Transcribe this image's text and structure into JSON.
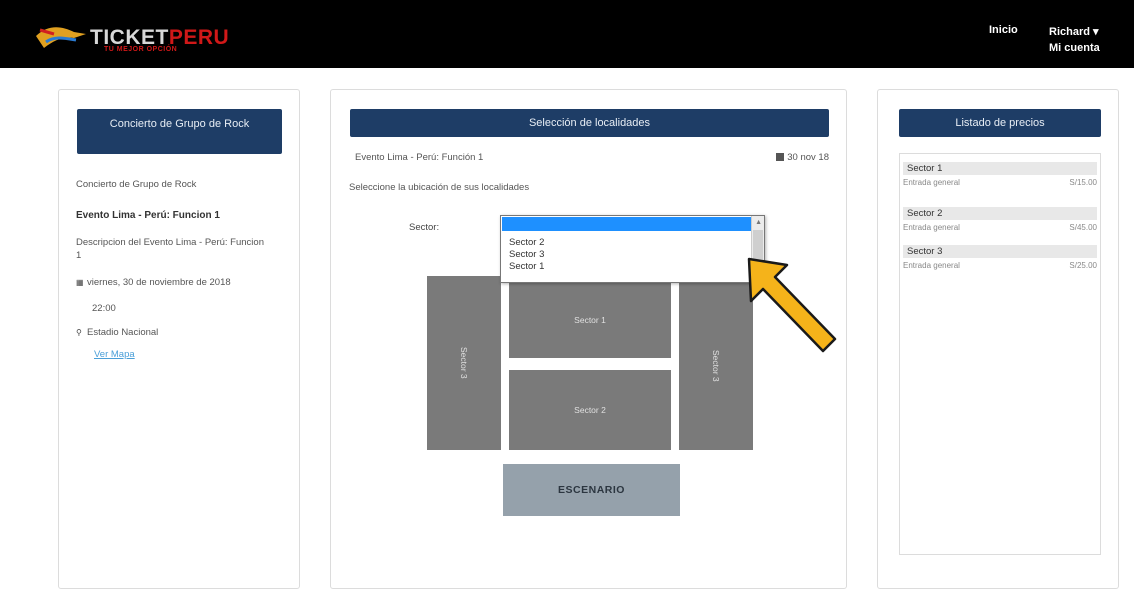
{
  "brand": {
    "name_part1": "TICKET",
    "name_part2": "PERU",
    "tagline": "TU MEJOR OPCIÓN"
  },
  "nav": {
    "inicio": "Inicio",
    "user": "Richard ▾",
    "account": "Mi cuenta"
  },
  "left": {
    "header": "Concierto de Grupo de Rock",
    "subtitle": "Concierto de Grupo de Rock",
    "event_title": "Evento Lima - Perú: Funcion 1",
    "description": "Descripcion del Evento Lima - Perú: Funcion 1",
    "date": "viernes, 30 de noviembre de 2018",
    "time": "22:00",
    "venue": "Estadio Nacional",
    "map_link": "Ver Mapa"
  },
  "mid": {
    "header": "Selección de localidades",
    "event": "Evento Lima - Perú: Función 1",
    "date": "30 nov 18",
    "instruction": "Seleccione la ubicación de sus localidades",
    "sector_label": "Sector:",
    "dropdown_options": [
      "Sector 2",
      "Sector 3",
      "Sector 1"
    ],
    "seat_map": {
      "left": "Sector 3",
      "top": "Sector 1",
      "right": "Sector 3",
      "bottom": "Sector 2",
      "stage": "ESCENARIO"
    }
  },
  "right": {
    "header": "Listado de precios",
    "sectors": [
      {
        "name": "Sector 1",
        "row": "Entrada general",
        "price": "S/15.00"
      },
      {
        "name": "Sector 2",
        "row": "Entrada general",
        "price": "S/45.00"
      },
      {
        "name": "Sector 3",
        "row": "Entrada general",
        "price": "S/25.00"
      }
    ]
  },
  "colors": {
    "header_blue": "#1e3d66",
    "selection_blue": "#1e90ff",
    "seat_gray": "#7a7a7a",
    "stage_gray": "#95a1ab",
    "pointer_yellow": "#f5b31a",
    "brand_red": "#d01818"
  }
}
